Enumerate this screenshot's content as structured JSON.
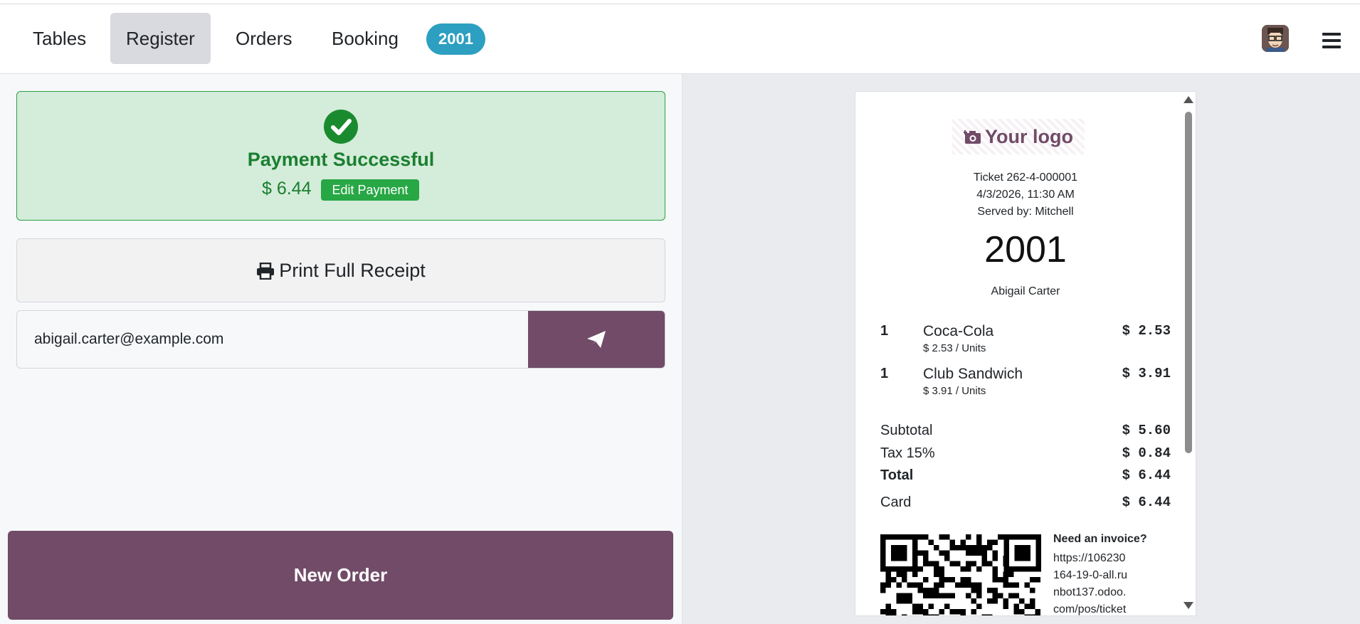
{
  "nav": {
    "tabs": [
      {
        "label": "Tables",
        "active": false
      },
      {
        "label": "Register",
        "active": true
      },
      {
        "label": "Orders",
        "active": false
      },
      {
        "label": "Booking",
        "active": false
      }
    ],
    "order_badge": "2001",
    "avatar_icon": "user-avatar-icon",
    "menu_icon": "hamburger-menu-icon"
  },
  "payment": {
    "status_icon": "check-circle-icon",
    "title": "Payment Successful",
    "amount": "$ 6.44",
    "edit_label": "Edit Payment"
  },
  "actions": {
    "print_label": "Print Full Receipt",
    "print_icon": "printer-icon",
    "email_value": "abigail.carter@example.com",
    "send_icon": "paper-plane-icon",
    "new_order_label": "New Order"
  },
  "receipt": {
    "logo_text": "Your logo",
    "logo_icon": "camera-plus-icon",
    "ticket": "Ticket 262-4-000001",
    "datetime": "4/3/2026, 11:30 AM",
    "served_by": "Served by: Mitchell",
    "order_number": "2001",
    "customer": "Abigail Carter",
    "lines": [
      {
        "qty": "1",
        "name": "Coca-Cola",
        "unit_price": "$ 2.53 / Units",
        "amount": "$ 2.53"
      },
      {
        "qty": "1",
        "name": "Club Sandwich",
        "unit_price": "$ 3.91 / Units",
        "amount": "$ 3.91"
      }
    ],
    "subtotal_label": "Subtotal",
    "subtotal": "$ 5.60",
    "tax_label": "Tax 15%",
    "tax": "$ 0.84",
    "total_label": "Total",
    "total": "$ 6.44",
    "payment_label": "Card",
    "payment_amount": "$ 6.44",
    "invoice_title": "Need an invoice?",
    "invoice_url": "https://106230164-19-0-all.runbot137.odoo.com/pos/ticket"
  },
  "colors": {
    "brand": "#714b67",
    "success": "#28a745",
    "badge": "#2d9fc0"
  }
}
